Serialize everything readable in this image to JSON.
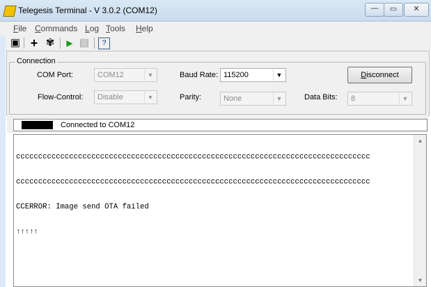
{
  "window": {
    "title": "Telegesis Terminal - V 3.0.2  (COM12)",
    "minimize": "—",
    "maximize": "▭",
    "close": "✕"
  },
  "menu": [
    {
      "label": "File",
      "key": "F",
      "rest": "ile"
    },
    {
      "label": "Commands",
      "key": "C",
      "rest": "ommands"
    },
    {
      "label": "Log",
      "key": "L",
      "rest": "og"
    },
    {
      "label": "Tools",
      "key": "T",
      "rest": "ools"
    },
    {
      "label": "Help",
      "key": "H",
      "rest": "elp"
    }
  ],
  "toolbar": {
    "save_icon": "▣",
    "add_icon": "+",
    "tool_icon": "✾",
    "run_icon": "▶",
    "script_icon": "▤",
    "help_icon": "?"
  },
  "connection": {
    "group_label": "Connection",
    "com_port_label": "COM Port:",
    "com_port_value": "COM12",
    "baud_rate_label": "Baud Rate:",
    "baud_rate_value": "115200",
    "flow_control_label": "Flow-Control:",
    "flow_control_value": "Disable",
    "parity_label": "Parity:",
    "parity_value": "None",
    "data_bits_label": "Data Bits:",
    "data_bits_value": "8",
    "disconnect_label": "Disconnect",
    "disconnect_key": "D",
    "disconnect_rest": "isconnect"
  },
  "status": {
    "text": "Connected to COM12"
  },
  "console": {
    "lines": [
      "cccccccccccccccccccccccccccccccccccccccccccccccccccccccccccccccccccccccccccccccc",
      "cccccccccccccccccccccccccccccccccccccccccccccccccccccccccccccccccccccccccccccccc",
      "CCERROR: Image send OTA failed",
      "↑↑↑↑↑"
    ]
  },
  "scrollbar": {
    "up": "▲",
    "down": "▼"
  }
}
